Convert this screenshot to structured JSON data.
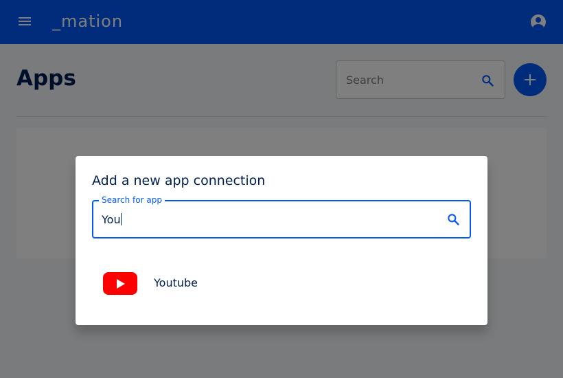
{
  "header": {
    "logo": "_mation",
    "menu_icon": "hamburger-menu-icon",
    "account_icon": "account-circle-icon"
  },
  "page": {
    "title": "Apps",
    "search_placeholder": "Search",
    "search_icon": "search-icon",
    "add_icon": "plus-icon"
  },
  "dialog": {
    "title": "Add a new app connection",
    "search_label": "Search for app",
    "search_value": "You",
    "search_icon": "search-icon",
    "results": [
      {
        "name": "Youtube",
        "icon": "youtube-logo-icon"
      }
    ]
  },
  "colors": {
    "primary": "#0059f7",
    "text_dark": "#001f52",
    "youtube_red": "#ff0000"
  }
}
